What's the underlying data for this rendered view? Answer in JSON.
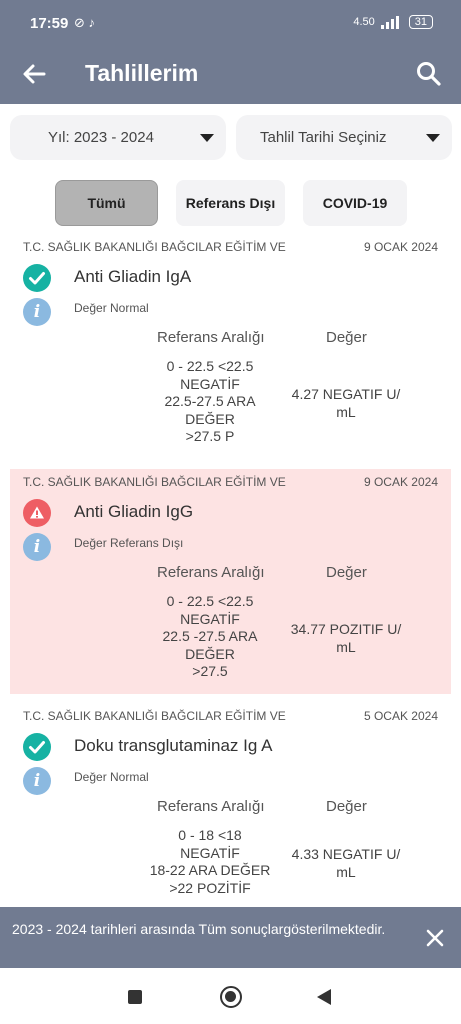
{
  "status_bar": {
    "time": "17:59",
    "notif_icons": "⊘ ♪",
    "network": "4.50",
    "battery": "31"
  },
  "app_bar": {
    "title": "Tahlillerim",
    "back_icon": "arrow-left-icon",
    "search_icon": "search-icon"
  },
  "filters": {
    "year": "Yıl: 2023 - 2024",
    "date_placeholder": "Tahlil Tarihi Seçiniz"
  },
  "tabs": [
    {
      "label": "Tümü",
      "active": true
    },
    {
      "label": "Referans Dışı",
      "active": false
    },
    {
      "label": "COVID-19",
      "active": false
    }
  ],
  "columns": {
    "range": "Referans Aralığı",
    "value": "Değer"
  },
  "results": [
    {
      "institution": "T.C. SAĞLIK BAKANLIĞI BAĞCILAR EĞİTİM VE",
      "date": "9 OCAK 2024",
      "test": "Anti Gliadin IgA",
      "state": "Değer Normal",
      "range": [
        "0 - 22.5 <22.5",
        "NEGATİF",
        "22.5-27.5 ARA",
        "DEĞER",
        ">27.5 P"
      ],
      "value": [
        "4.27 NEGATIF U/",
        "mL"
      ],
      "status_color": "#16b2a3"
    },
    {
      "institution": "T.C. SAĞLIK BAKANLIĞI BAĞCILAR EĞİTİM VE",
      "date": "9 OCAK 2024",
      "test": "Anti Gliadin IgG",
      "state": "Değer Referans Dışı",
      "range": [
        "0 - 22.5 <22.5",
        "NEGATİF",
        "22.5 -27.5 ARA",
        "DEĞER",
        ">27.5"
      ],
      "value": [
        "34.77 POZITIF U/",
        "mL"
      ],
      "status_color": "#ee5e64"
    },
    {
      "institution": "T.C. SAĞLIK BAKANLIĞI BAĞCILAR EĞİTİM VE",
      "date": "5 OCAK 2024",
      "test": "Doku transglutaminaz Ig A",
      "state": "Değer Normal",
      "range": [
        "0 - 18 <18",
        "NEGATİF",
        "18-22 ARA DEĞER",
        ">22 POZİTİF"
      ],
      "value": [
        "4.33 NEGATIF U/",
        "mL"
      ],
      "status_color": "#16b2a3"
    }
  ],
  "snackbar": {
    "message": "2023 - 2024 tarihleri arasında Tüm sonuçlargösterilmektedir.",
    "close_icon": "close-icon"
  },
  "nav": {
    "recents_icon": "square-icon",
    "home_icon": "circle-icon",
    "back_icon": "triangle-back-icon"
  },
  "colors": {
    "primary": "#717b91",
    "alert_bg": "#fde3e3",
    "ok": "#16b2a3",
    "warn": "#ee5e64",
    "info": "#8bb9e0"
  }
}
